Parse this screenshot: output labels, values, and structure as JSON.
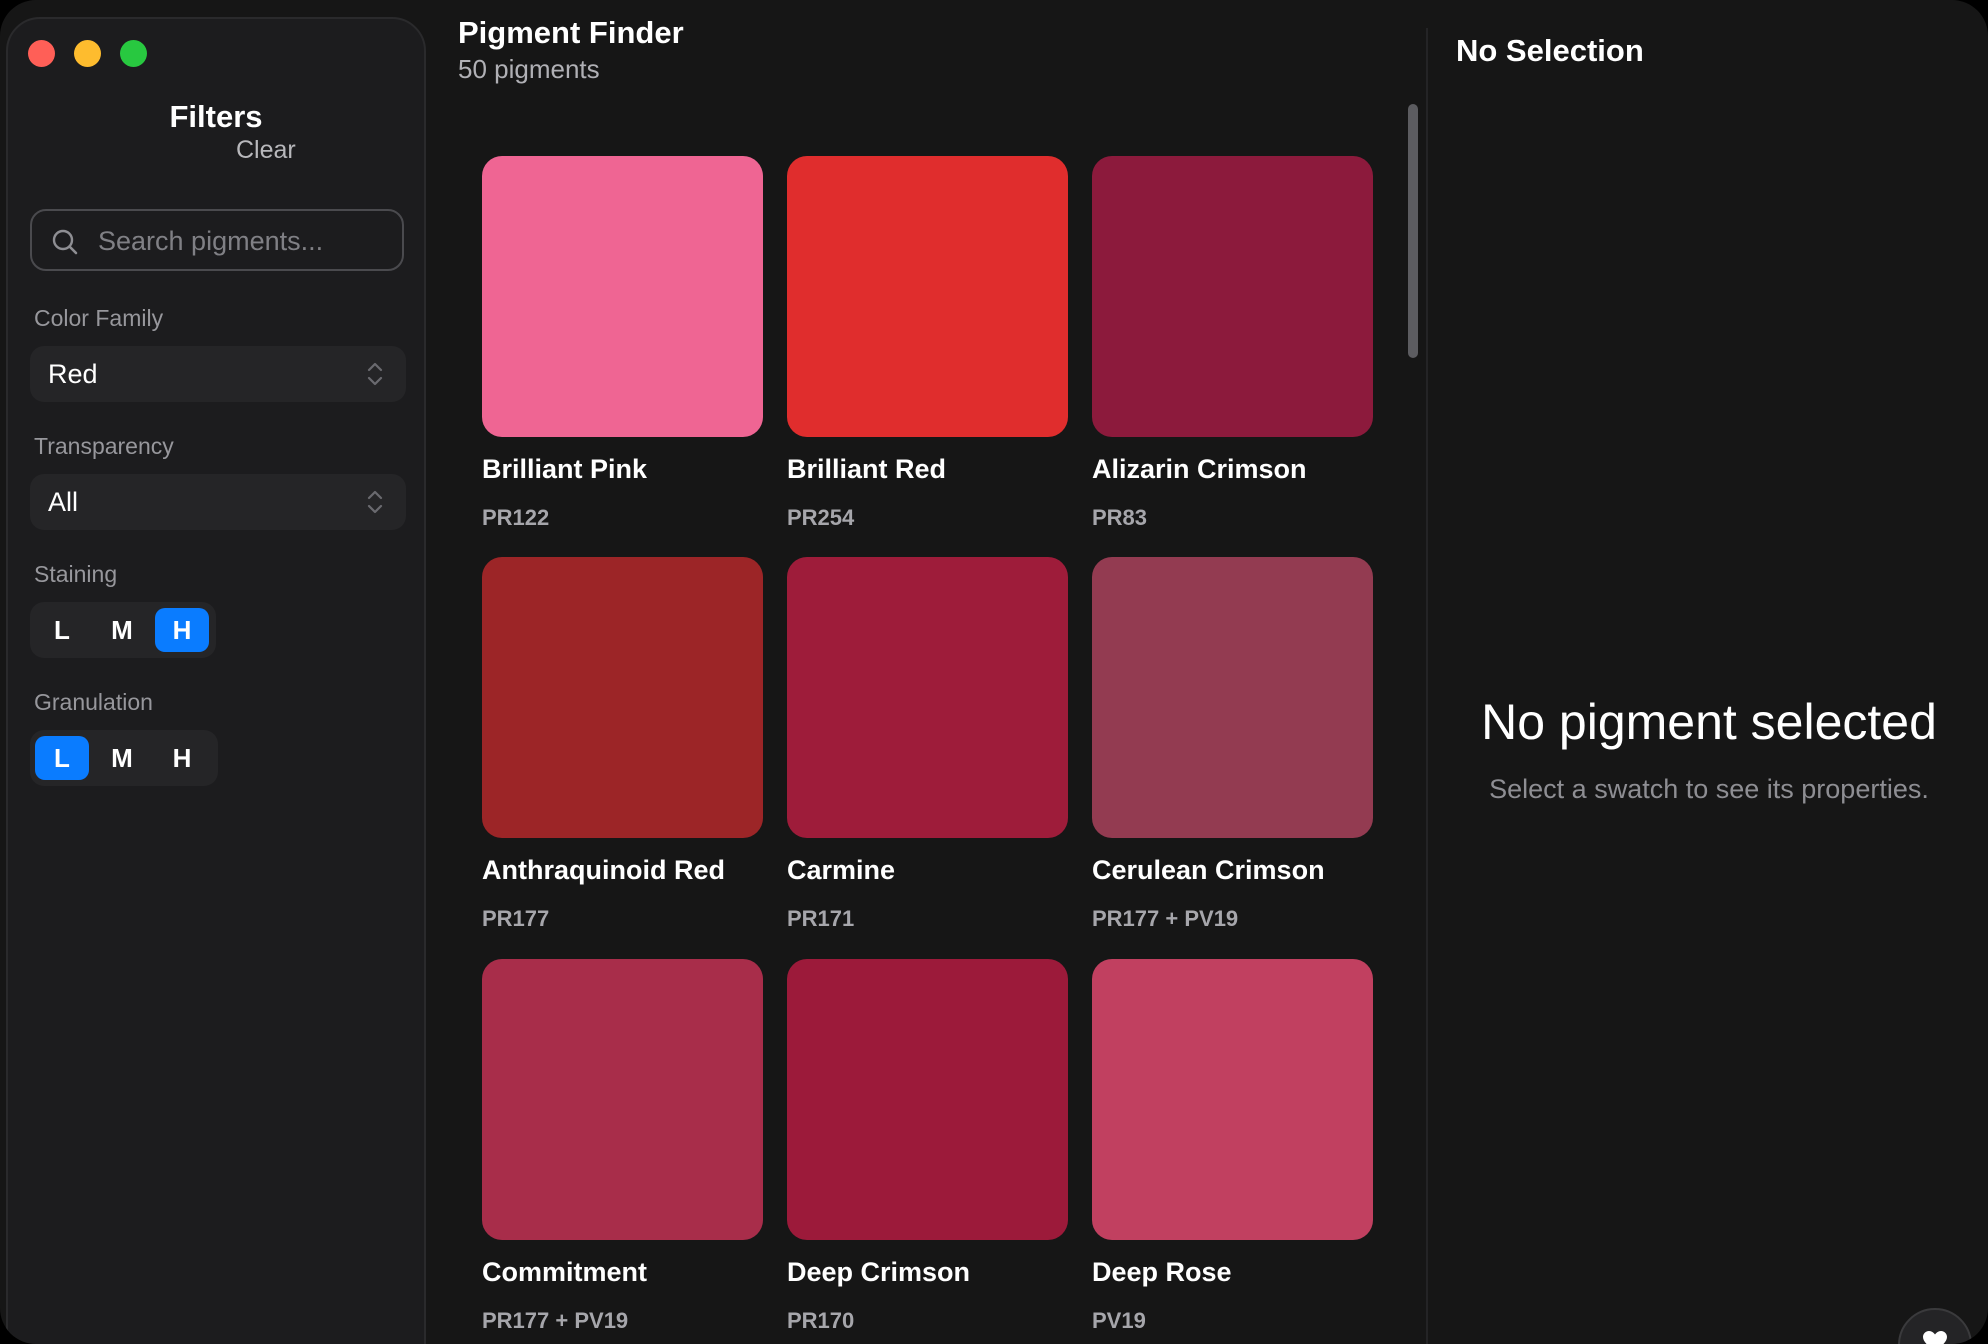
{
  "window": {
    "traffic_lights": {
      "close": "#ff5f57",
      "minimize": "#febc2e",
      "maximize": "#28c840"
    }
  },
  "sidebar": {
    "title": "Filters",
    "clear_label": "Clear",
    "search": {
      "placeholder": "Search pigments...",
      "value": "",
      "icon": "search-icon"
    },
    "color_family": {
      "label": "Color Family",
      "value": "Red"
    },
    "transparency": {
      "label": "Transparency",
      "value": "All"
    },
    "staining": {
      "label": "Staining",
      "options": [
        "L",
        "M",
        "H"
      ],
      "selected": "H"
    },
    "granulation": {
      "label": "Granulation",
      "options": [
        "L",
        "M",
        "H"
      ],
      "selected": "L"
    }
  },
  "main": {
    "title": "Pigment Finder",
    "subtitle": "50 pigments",
    "scroll_position": 0,
    "pigments": [
      {
        "name": "Brilliant Pink",
        "code": "PR122",
        "color": "#ef6593"
      },
      {
        "name": "Brilliant Red",
        "code": "PR254",
        "color": "#e02d2d"
      },
      {
        "name": "Alizarin Crimson",
        "code": "PR83",
        "color": "#8c1a3c"
      },
      {
        "name": "Anthraquinoid Red",
        "code": "PR177",
        "color": "#9c2527"
      },
      {
        "name": "Carmine",
        "code": "PR171",
        "color": "#9e1c3a"
      },
      {
        "name": "Cerulean Crimson",
        "code": "PR177 + PV19",
        "color": "#933b51"
      },
      {
        "name": "Commitment",
        "code": "PR177 + PV19",
        "color": "#a82d4a"
      },
      {
        "name": "Deep Crimson",
        "code": "PR170",
        "color": "#9c1a3a"
      },
      {
        "name": "Deep Rose",
        "code": "PV19",
        "color": "#c14060"
      }
    ]
  },
  "detail": {
    "title": "No Selection",
    "empty_heading": "No pigment selected",
    "empty_subtitle": "Select a swatch to see its properties."
  },
  "theme": {
    "accent": "#0a7cff",
    "background": "#161616",
    "sidebar": "#1c1c1e"
  }
}
